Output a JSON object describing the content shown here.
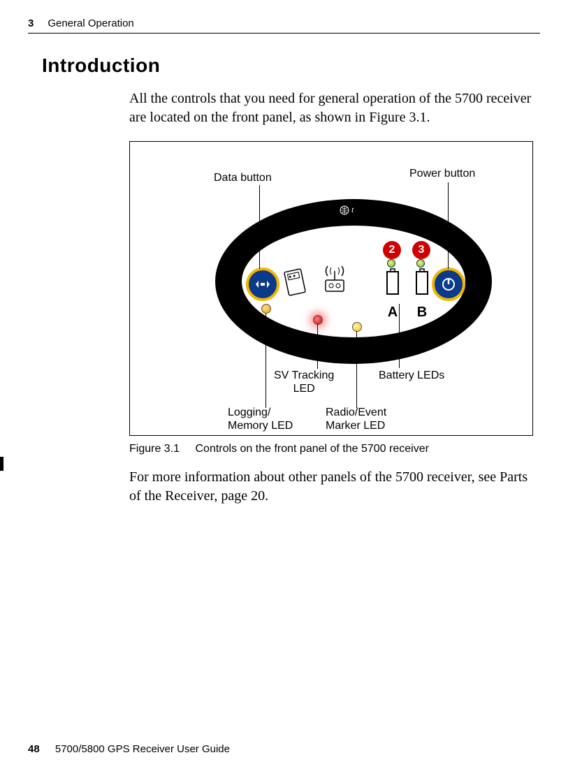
{
  "header": {
    "chapter_number": "3",
    "chapter_title": "General Operation"
  },
  "section": {
    "title": "Introduction"
  },
  "paragraphs": {
    "intro": "All the controls that you need for general operation of the 5700 receiver are located on the front panel, as shown in Figure 3.1.",
    "after_fig": "For more information about other panels of the 5700 receiver, see Parts of the Receiver, page 20."
  },
  "figure": {
    "number": "Figure 3.1",
    "caption": "Controls on the front panel of the 5700 receiver",
    "callouts": {
      "data_button": "Data button",
      "power_button": "Power button",
      "sv_tracking_led_l1": "SV Tracking",
      "sv_tracking_led_l2": "LED",
      "battery_leds": "Battery LEDs",
      "logging_memory_l1": "Logging/",
      "logging_memory_l2": "Memory LED",
      "radio_event_l1": "Radio/Event",
      "radio_event_l2": "Marker LED"
    },
    "panel": {
      "battery_a_label": "A",
      "battery_b_label": "B",
      "battery_a_num": "2",
      "battery_b_num": "3"
    }
  },
  "footer": {
    "page_number": "48",
    "doc_title": "5700/5800 GPS Receiver User Guide"
  }
}
